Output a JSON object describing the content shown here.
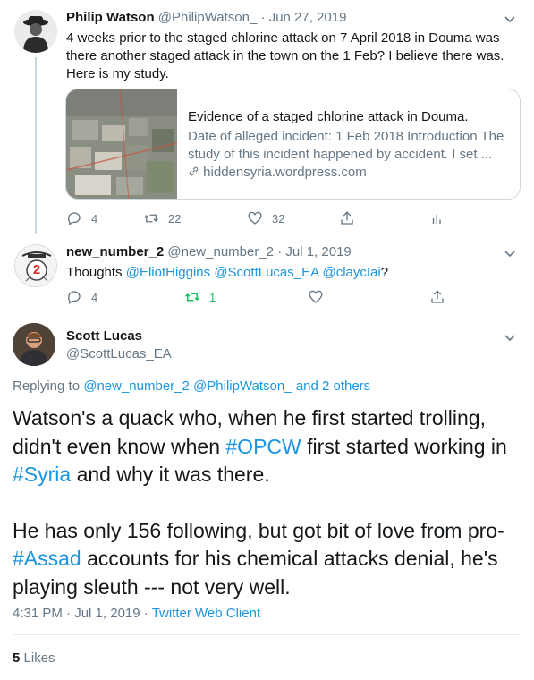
{
  "tweets": [
    {
      "name": "Philip Watson",
      "handle": "@PhilipWatson_",
      "separator": "·",
      "date": "Jun 27, 2019",
      "text": "4 weeks prior to the staged chlorine attack on 7 April 2018 in Douma was there another staged attack in the town on the 1 Feb? I believe there was. Here is my study.",
      "card": {
        "title": "Evidence of a staged chlorine attack in Douma.",
        "description": "Date of alleged incident: 1 Feb 2018 Introduction The study of this incident happened by accident. I set ...",
        "domain": "hiddensyria.wordpress.com"
      },
      "actions": {
        "replies": "4",
        "retweets": "22",
        "likes": "32"
      }
    },
    {
      "name": "new_number_2",
      "handle": "@new_number_2",
      "separator": "·",
      "date": "Jul 1, 2019",
      "text_prefix": "Thoughts ",
      "mentions": [
        "@EliotHiggins",
        "@ScottLucas_EA",
        "@claycIai"
      ],
      "text_suffix": "?",
      "avatar_label": "2",
      "actions": {
        "replies": "4",
        "retweets": "1",
        "likes": ""
      }
    }
  ],
  "main_tweet": {
    "name": "Scott Lucas",
    "handle": "@ScottLucas_EA",
    "replying_label": "Replying to",
    "replying_mentions": [
      "@new_number_2",
      "@PhilipWatson_"
    ],
    "replying_and": "and",
    "replying_others": "2 others",
    "p1_a": "Watson's a quack who, when he first started trolling, didn't even know when ",
    "p1_hashtag1": "#OPCW",
    "p1_b": " first started working in ",
    "p1_hashtag2": "#Syria",
    "p1_c": " and why it was there.",
    "p2_a": "He has only 156 following, but got bit of love from pro-",
    "p2_hashtag": "#Assad",
    "p2_b": " accounts for his chemical attacks denial, he's playing sleuth --- not very well.",
    "time": "4:31 PM",
    "date": "Jul 1, 2019",
    "separator": "·",
    "client": "Twitter Web Client",
    "likes_count": "5",
    "likes_label": "Likes"
  },
  "colors": {
    "link": "#1b95e0",
    "secondary": "#657786",
    "retweet_active": "#17bf63",
    "border": "#ccd6dd"
  }
}
